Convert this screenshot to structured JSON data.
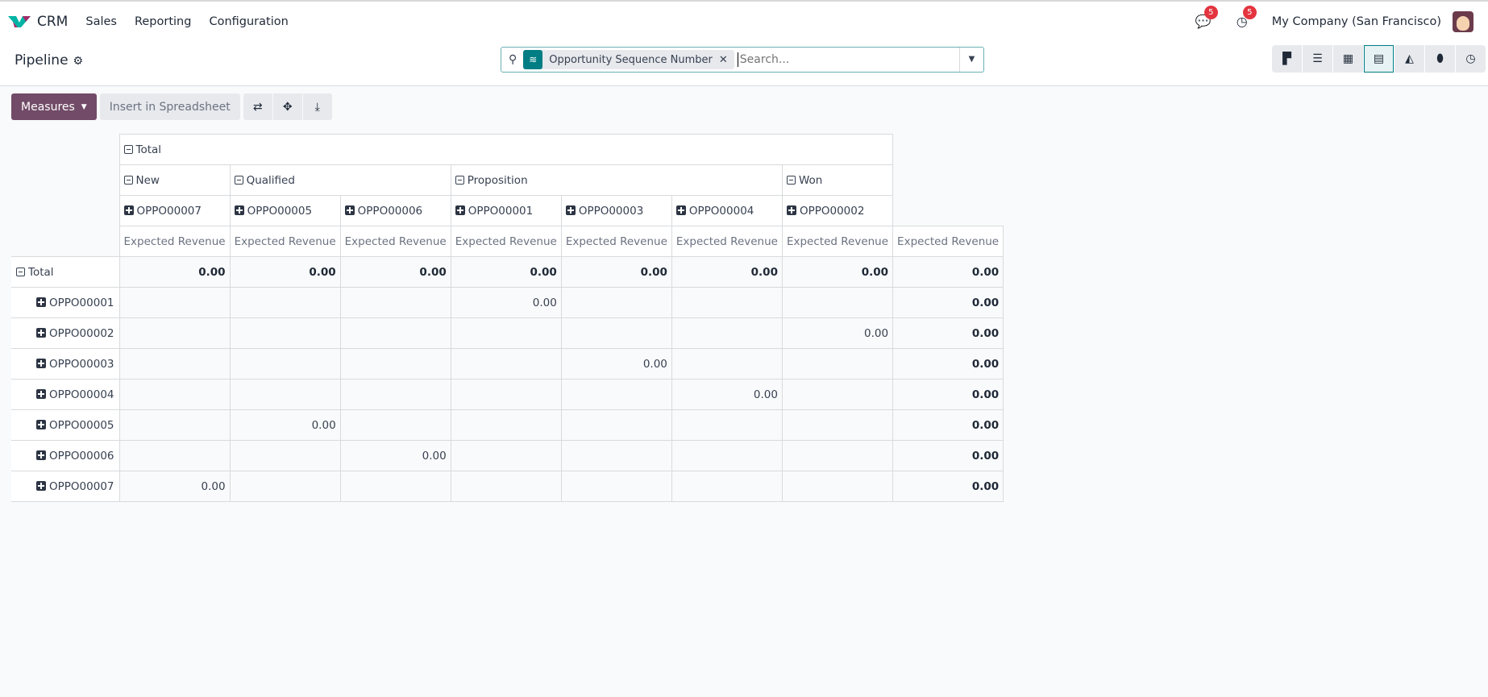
{
  "nav": {
    "app": "CRM",
    "menus": [
      "Sales",
      "Reporting",
      "Configuration"
    ],
    "messages_count": "5",
    "activities_count": "5",
    "company": "My Company (San Francisco)"
  },
  "control": {
    "title": "Pipeline",
    "facet": "Opportunity Sequence Number",
    "search_placeholder": "Search..."
  },
  "toolbar": {
    "measures": "Measures",
    "insert": "Insert in Spreadsheet"
  },
  "pivot": {
    "col_total": "Total",
    "stages": [
      {
        "label": "New",
        "span": 1
      },
      {
        "label": "Qualified",
        "span": 2
      },
      {
        "label": "Proposition",
        "span": 3
      },
      {
        "label": "Won",
        "span": 1
      }
    ],
    "col_opps": [
      "OPPO00007",
      "OPPO00005",
      "OPPO00006",
      "OPPO00001",
      "OPPO00003",
      "OPPO00004",
      "OPPO00002"
    ],
    "measure": "Expected Revenue",
    "total_row": {
      "label": "Total",
      "values": [
        "0.00",
        "0.00",
        "0.00",
        "0.00",
        "0.00",
        "0.00",
        "0.00",
        "0.00"
      ]
    },
    "rows": [
      {
        "label": "OPPO00001",
        "values": [
          "",
          "",
          "",
          "0.00",
          "",
          "",
          "",
          "0.00"
        ]
      },
      {
        "label": "OPPO00002",
        "values": [
          "",
          "",
          "",
          "",
          "",
          "",
          "0.00",
          "0.00"
        ]
      },
      {
        "label": "OPPO00003",
        "values": [
          "",
          "",
          "",
          "",
          "0.00",
          "",
          "",
          "0.00"
        ]
      },
      {
        "label": "OPPO00004",
        "values": [
          "",
          "",
          "",
          "",
          "",
          "0.00",
          "",
          "0.00"
        ]
      },
      {
        "label": "OPPO00005",
        "values": [
          "",
          "0.00",
          "",
          "",
          "",
          "",
          "",
          "0.00"
        ]
      },
      {
        "label": "OPPO00006",
        "values": [
          "",
          "",
          "0.00",
          "",
          "",
          "",
          "",
          "0.00"
        ]
      },
      {
        "label": "OPPO00007",
        "values": [
          "0.00",
          "",
          "",
          "",
          "",
          "",
          "",
          "0.00"
        ]
      }
    ]
  }
}
